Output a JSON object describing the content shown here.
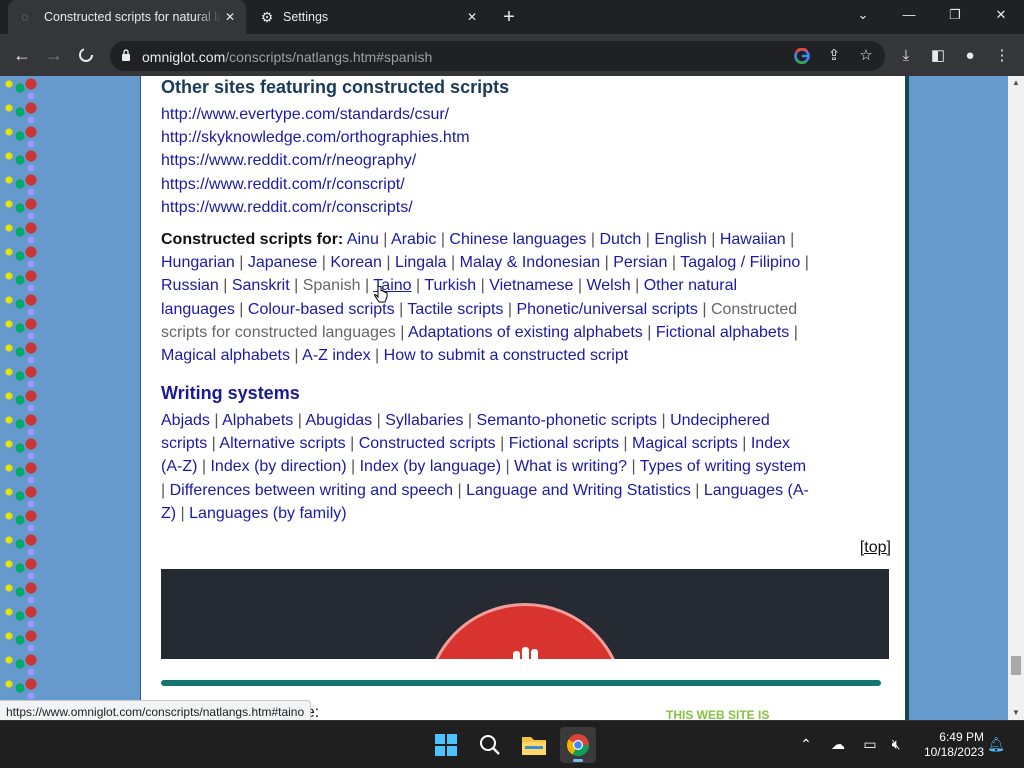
{
  "browser": {
    "tabs": [
      {
        "title": "Constructed scripts for natural la",
        "active": true
      },
      {
        "title": "Settings",
        "active": false
      }
    ],
    "url_host": "omniglot.com",
    "url_path": "/conscripts/natlangs.htm#spanish",
    "status_url": "https://www.omniglot.com/conscripts/natlangs.htm#taino"
  },
  "page": {
    "other_sites_heading": "Other sites featuring constructed scripts",
    "other_sites": [
      "http://www.evertype.com/standards/csur/",
      "http://skyknowledge.com/orthographies.htm",
      "https://www.reddit.com/r/neography/",
      "https://www.reddit.com/r/conscript/",
      "https://www.reddit.com/r/conscripts/"
    ],
    "cs_label": "Constructed scripts for:",
    "cs_links": [
      "Ainu",
      "Arabic",
      "Chinese languages",
      "Dutch",
      "English",
      "Hawaiian",
      "Hungarian",
      "Japanese",
      "Korean",
      "Lingala",
      "Malay & Indonesian",
      "Persian",
      "Tagalog / Filipino",
      "Russian",
      "Sanskrit",
      "Spanish",
      "Taino",
      "Turkish",
      "Vietnamese",
      "Welsh",
      "Other natural languages",
      "Colour-based scripts",
      "Tactile scripts",
      "Phonetic/universal scripts",
      "Constructed scripts for constructed languages",
      "Adaptations of existing alphabets",
      "Fictional alphabets",
      "Magical alphabets",
      "A-Z index",
      "How to submit a constructed script"
    ],
    "writing_heading": "Writing systems",
    "ws_links": [
      "Abjads",
      "Alphabets",
      "Abugidas",
      "Syllabaries",
      "Semanto-phonetic scripts",
      "Undeciphered scripts",
      "Alternative scripts",
      "Constructed scripts",
      "Fictional scripts",
      "Magical scripts",
      "Index (A-Z)",
      "Index (by direction)",
      "Index (by language)",
      "What is writing?",
      "Types of writing system",
      "Differences between writing and speech",
      "Language and Writing Statistics",
      "Languages (A-Z)",
      "Languages (by family)"
    ],
    "top_link": "[top]",
    "snippet": "ge:",
    "logo_text": "THIS WEB SITE IS"
  },
  "taskbar": {
    "time": "6:49 PM",
    "date": "10/18/2023"
  },
  "colors": {
    "link": "#1a1aa6",
    "page_bg": "#6699cc",
    "teal": "#137470"
  }
}
